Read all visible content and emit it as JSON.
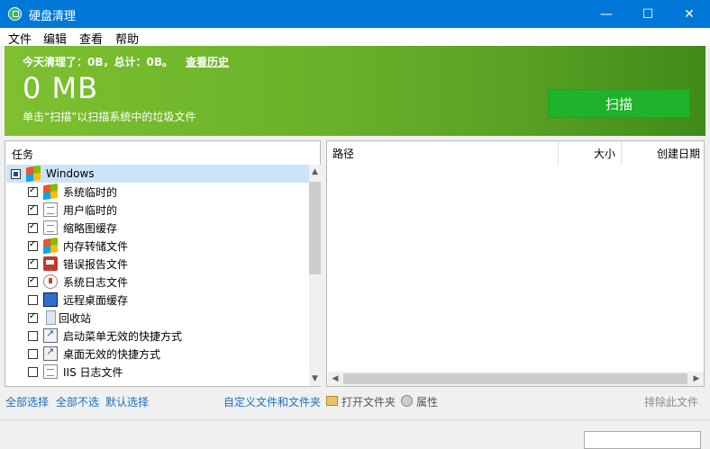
{
  "window": {
    "title": "硬盘清理",
    "minimize": "—",
    "maximize": "☐",
    "close": "✕"
  },
  "menu": [
    "文件",
    "编辑",
    "查看",
    "帮助"
  ],
  "banner": {
    "today_cleaned": "今天清理了：0B，总计：0B。",
    "history_link": "查看历史",
    "size": "0 MB",
    "hint": "单击“扫描”以扫描系统中的垃圾文件",
    "scan_button": "扫描"
  },
  "tasks": {
    "header": "任务",
    "items": [
      {
        "label": "Windows",
        "state": "partial",
        "icon": "windows-logo-icon",
        "level": 0
      },
      {
        "label": "系统临时的",
        "state": "checked",
        "icon": "windows-logo-icon",
        "level": 1
      },
      {
        "label": "用户临时的",
        "state": "checked",
        "icon": "document-icon",
        "level": 1
      },
      {
        "label": "缩略图缓存",
        "state": "checked",
        "icon": "document-icon",
        "level": 1
      },
      {
        "label": "内存转储文件",
        "state": "checked",
        "icon": "windows-logo-icon",
        "level": 1
      },
      {
        "label": "错误报告文件",
        "state": "checked",
        "icon": "error-report-icon",
        "level": 1
      },
      {
        "label": "系统日志文件",
        "state": "checked",
        "icon": "log-icon",
        "level": 1
      },
      {
        "label": "远程桌面缓存",
        "state": "unchecked",
        "icon": "monitor-icon",
        "level": 1
      },
      {
        "label": "回收站",
        "state": "checked",
        "icon": "recycle-bin-icon",
        "level": 1
      },
      {
        "label": "启动菜单无效的快捷方式",
        "state": "unchecked",
        "icon": "shortcut-icon",
        "level": 1
      },
      {
        "label": "桌面无效的快捷方式",
        "state": "unchecked",
        "icon": "shortcut-icon",
        "level": 1
      },
      {
        "label": "IIS 日志文件",
        "state": "unchecked",
        "icon": "document-icon",
        "level": 1
      }
    ]
  },
  "files": {
    "columns": [
      "路径",
      "大小",
      "创建日期"
    ]
  },
  "actions": {
    "select_all": "全部选择",
    "select_none": "全部不选",
    "default_select": "默认选择",
    "custom_files": "自定义文件和文件夹",
    "open_folder": "打开文件夹",
    "properties": "属性",
    "exclude_file": "排除此文件"
  },
  "colors": {
    "titlebar": "#0078d7",
    "banner": "#6ab22a",
    "scan_button": "#1fb22a",
    "link": "#1a6fbf"
  }
}
